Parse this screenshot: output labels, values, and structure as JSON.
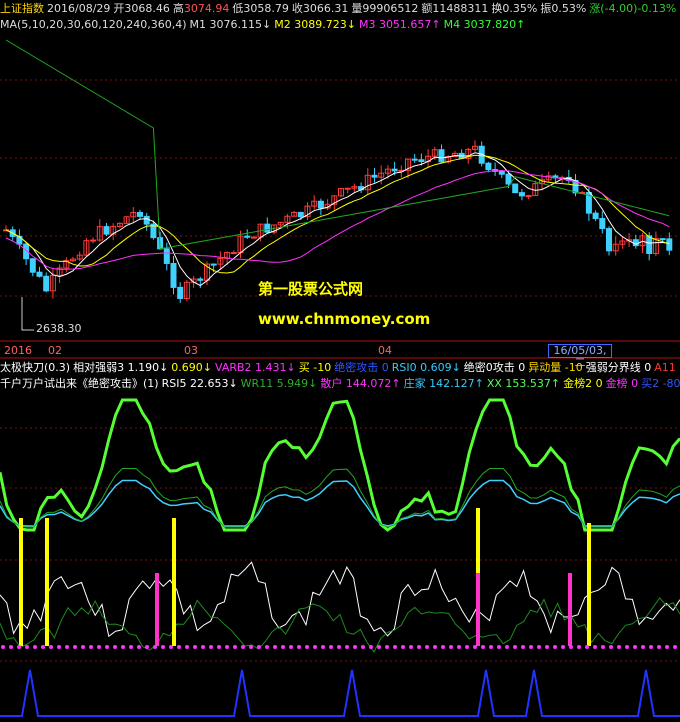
{
  "header1": {
    "name": "上证指数",
    "date": "2016/08/29",
    "open_label": "开",
    "open": "3068.46",
    "high_label": "高",
    "high": "3074.94",
    "low_label": "低",
    "low": "3058.79",
    "close_label": "收",
    "close": "3066.31",
    "vol_label": "量",
    "vol": "99906512",
    "amt_label": "额",
    "amt": "11488311",
    "turn_label": "换",
    "turn": "0.35%",
    "amp_label": "振",
    "amp": "0.53%",
    "chg": "涨(-4.00)-0.13%"
  },
  "header2": {
    "ma": "MA(5,10,20,30,60,120,240,360,4)",
    "m1": "M1 3076.115↓",
    "m2": "M2 3089.723↓",
    "m3": "M3 3051.657↑",
    "m4": "M4 3037.820↑"
  },
  "price_labels": {
    "low_mark": "2638.30"
  },
  "watermark": {
    "line1": "第一股票公式网",
    "line2": "www.chnmoney.com"
  },
  "axis": {
    "y2016": "2016",
    "m02": "02",
    "m03": "03",
    "m04": "04",
    "cursor": "16/05/03,二"
  },
  "ind1": [
    {
      "t": "太极快刀(0.3)",
      "c": "#ffffff"
    },
    {
      "t": "相对强弱3 1.190↓",
      "c": "#ffffff"
    },
    {
      "t": "0.690↓",
      "c": "#ffff00"
    },
    {
      "t": "VARB2 1.431↓",
      "c": "#ff33ff"
    },
    {
      "t": "买 -10",
      "c": "#ffff00"
    },
    {
      "t": "绝密攻击 0",
      "c": "#3355ff"
    },
    {
      "t": "RSI0 0.609↓",
      "c": "#33ccff"
    },
    {
      "t": "绝密0攻击 0",
      "c": "#ffffff"
    },
    {
      "t": "异动量 -10",
      "c": "#ffd700"
    },
    {
      "t": "强弱分界线 0",
      "c": "#ffffff"
    },
    {
      "t": "A11 0",
      "c": "#ff3333"
    }
  ],
  "ind2": [
    {
      "t": "千户万户试出来《绝密攻击》(1)",
      "c": "#ffffff"
    },
    {
      "t": "RSI5 22.653↓",
      "c": "#ffffff"
    },
    {
      "t": "WR11 5.949↓",
      "c": "#33aa33"
    },
    {
      "t": "散户 144.072↑",
      "c": "#ff33ff"
    },
    {
      "t": "庄家 142.127↑",
      "c": "#33ccff"
    },
    {
      "t": "XX 153.537↑",
      "c": "#55ff55"
    },
    {
      "t": "金榜2 0",
      "c": "#ffff00"
    },
    {
      "t": "金榜 0",
      "c": "#ff33ff"
    },
    {
      "t": "买2 -80",
      "c": "#3355ff"
    }
  ]
}
